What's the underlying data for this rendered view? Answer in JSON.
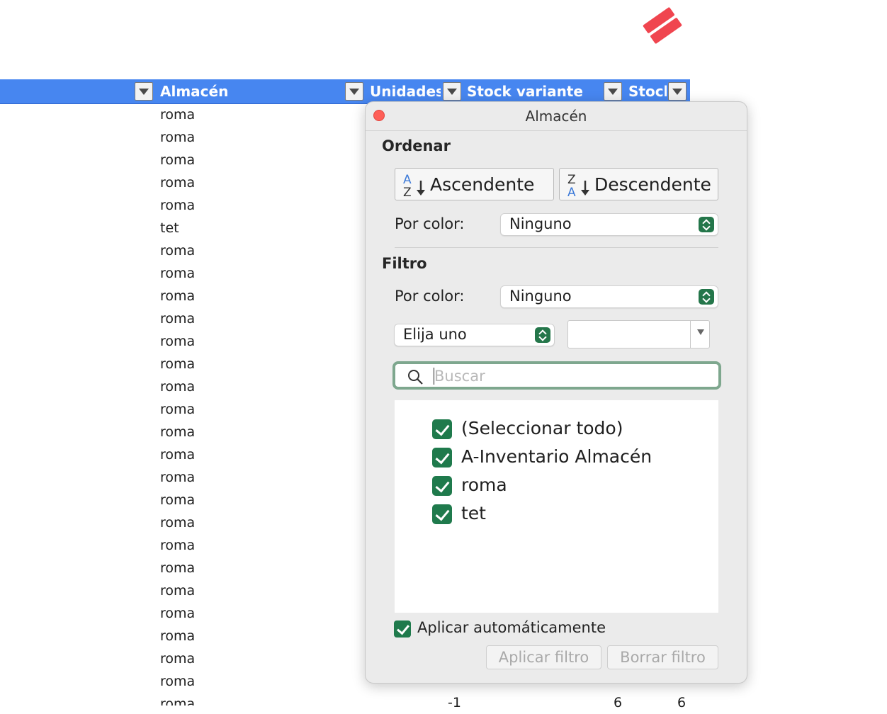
{
  "header": {
    "columns": [
      "Almacén",
      "Unidades",
      "Stock variante",
      "Stock"
    ]
  },
  "column_values": [
    "roma",
    "roma",
    "roma",
    "roma",
    "roma",
    "tet",
    "roma",
    "roma",
    "roma",
    "roma",
    "roma",
    "roma",
    "roma",
    "roma",
    "roma",
    "roma",
    "roma",
    "roma",
    "roma",
    "roma",
    "roma",
    "roma",
    "roma",
    "roma",
    "roma",
    "roma"
  ],
  "last_row": {
    "cell": "roma",
    "unidades": "-1",
    "stock_variante": "6",
    "stock": "6"
  },
  "popover": {
    "title": "Almacén",
    "sort": {
      "heading": "Ordenar",
      "ascending_label": "Ascendente",
      "descending_label": "Descendente",
      "color_label": "Por color:",
      "color_value": "Ninguno"
    },
    "filter": {
      "heading": "Filtro",
      "color_label": "Por color:",
      "color_value": "Ninguno",
      "condition_value": "Elija uno",
      "condition_input": "",
      "search_placeholder": "Buscar",
      "items": [
        "(Seleccionar todo)",
        "A-Inventario Almacén",
        "roma",
        "tet"
      ],
      "items_checked": [
        true,
        true,
        true,
        true
      ]
    },
    "auto_apply_label": "Aplicar automáticamente",
    "apply_label": "Aplicar filtro",
    "clear_label": "Borrar filtro"
  },
  "colors": {
    "header_bg": "#4786f0",
    "check_green": "#1f7a4c",
    "logo_red": "#f0454f"
  },
  "icons": [
    "logo-icon",
    "filter-dropdown-icon",
    "sort-az-icon",
    "sort-za-icon",
    "search-icon",
    "check-icon",
    "close-icon"
  ]
}
